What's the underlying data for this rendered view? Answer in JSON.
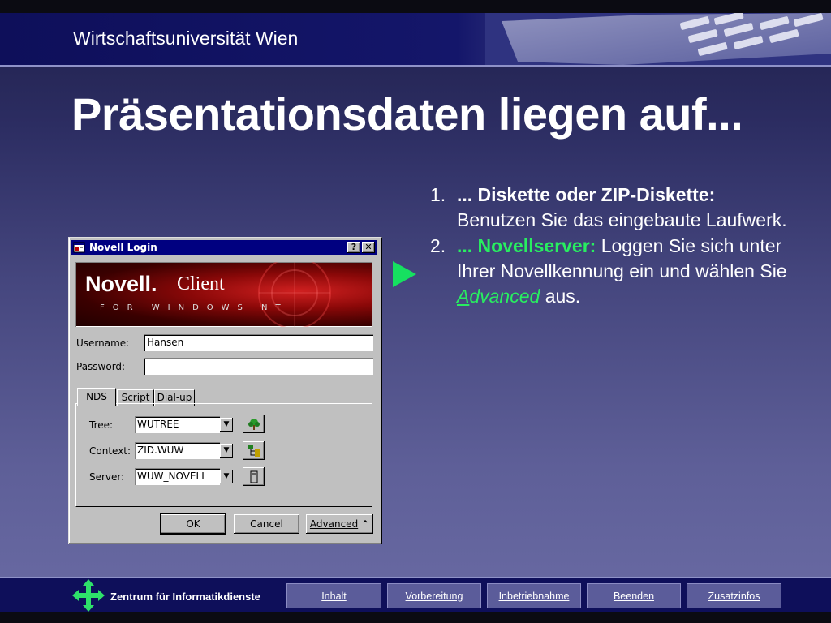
{
  "header": {
    "university": "Wirtschaftsuniversität Wien"
  },
  "slide": {
    "title": "Präsentationsdaten liegen auf..."
  },
  "dialog": {
    "title": "Novell Login",
    "help_btn": "?",
    "close_btn": "✕",
    "banner_brand": "Novell.",
    "banner_product": "Client",
    "banner_sub": "FOR WINDOWS NT",
    "username_label": "Username:",
    "username_value": "Hansen",
    "password_label": "Password:",
    "password_value": "",
    "tabs": [
      "NDS",
      "Script",
      "Dial-up"
    ],
    "tree_label": "Tree:",
    "tree_value": "WUTREE",
    "context_label": "Context:",
    "context_value": "ZID.WUW",
    "server_label": "Server:",
    "server_value": "WUW_NOVELL",
    "ok_label": "OK",
    "cancel_label": "Cancel",
    "advanced_label": "Advanced",
    "advanced_icon": "chevron-up-double"
  },
  "content": {
    "item1_num": "1.",
    "item1_bold": "... Diskette oder ZIP-Diskette:",
    "item1_text": "Benutzen Sie das eingebaute Laufwerk.",
    "item2_num": "2.",
    "item2_highlight": "... Novellserver:",
    "item2_text": "Loggen Sie sich unter Ihrer Novellkennung ein und wählen Sie",
    "item2_adv_underlined": "A",
    "item2_adv_rest": "dvanced",
    "item2_end": "aus."
  },
  "footer": {
    "department": "Zentrum für Informatikdienste",
    "nav": [
      "Inhalt",
      "Vorbereitung",
      "Inbetriebnahme",
      "Beenden",
      "Zusatzinfos"
    ]
  },
  "colors": {
    "accent_green": "#28ee60",
    "header_navy": "#0e0f5a",
    "nav_button": "#5b5c9a"
  }
}
